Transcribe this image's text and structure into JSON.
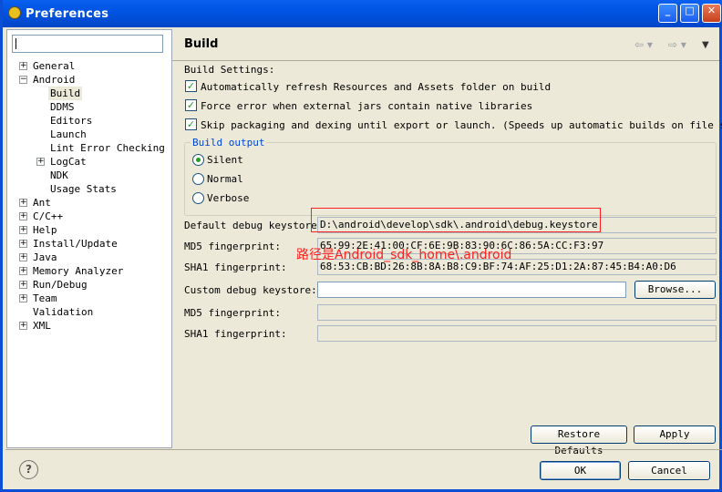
{
  "window": {
    "title": "Preferences",
    "min_glyph": "_",
    "max_glyph": "□",
    "close_glyph": "✕"
  },
  "filter": {
    "value": ""
  },
  "tree": [
    {
      "label": "General",
      "expander": "+"
    },
    {
      "label": "Android",
      "expander": "−"
    },
    {
      "label": "Build",
      "selected": true
    },
    {
      "label": "DDMS"
    },
    {
      "label": "Editors"
    },
    {
      "label": "Launch"
    },
    {
      "label": "Lint Error Checking"
    },
    {
      "label": "LogCat",
      "expander": "+"
    },
    {
      "label": "NDK"
    },
    {
      "label": "Usage Stats"
    },
    {
      "label": "Ant",
      "expander": "+"
    },
    {
      "label": "C/C++",
      "expander": "+"
    },
    {
      "label": "Help",
      "expander": "+"
    },
    {
      "label": "Install/Update",
      "expander": "+"
    },
    {
      "label": "Java",
      "expander": "+"
    },
    {
      "label": "Memory Analyzer",
      "expander": "+"
    },
    {
      "label": "Run/Debug",
      "expander": "+"
    },
    {
      "label": "Team",
      "expander": "+"
    },
    {
      "label": "Validation"
    },
    {
      "label": "XML",
      "expander": "+"
    }
  ],
  "page": {
    "title": "Build",
    "nav_back": "⇦ ▾",
    "nav_forward": "⇨ ▾",
    "nav_menu": "▼",
    "settings_label": "Build Settings:",
    "checkboxes": [
      {
        "label": "Automatically refresh Resources and Assets folder on build",
        "checked": true
      },
      {
        "label": "Force error when external jars contain native libraries",
        "checked": true
      },
      {
        "label": "Skip packaging and dexing until export or launch. (Speeds up automatic builds on file save)",
        "checked": true
      }
    ],
    "check_glyph": "✓",
    "build_output": {
      "title": "Build output",
      "options": [
        {
          "label": "Silent",
          "selected": true
        },
        {
          "label": "Normal",
          "selected": false
        },
        {
          "label": "Verbose",
          "selected": false
        }
      ]
    },
    "default_keystore_label": "Default debug keystore:",
    "default_keystore_value": "D:\\android\\develop\\sdk\\.android\\debug.keystore",
    "md5_label": "MD5 fingerprint:",
    "md5_value": "65:99:2E:41:00:CF:6E:9B:83:90:6C:86:5A:CC:F3:97",
    "sha1_label": "SHA1 fingerprint:",
    "sha1_value": "68:53:CB:BD:26:8B:8A:B8:C9:BF:74:AF:25:D1:2A:87:45:B4:A0:D6",
    "custom_keystore_label": "Custom debug keystore:",
    "custom_keystore_value": "",
    "browse_label": "Browse...",
    "custom_md5_label": "MD5 fingerprint:",
    "custom_md5_value": "",
    "custom_sha1_label": "SHA1 fingerprint:",
    "custom_sha1_value": "",
    "restore_defaults_label": "Restore Defaults",
    "apply_label": "Apply"
  },
  "annotation": {
    "text": "路径是Android_sdk_home\\.android",
    "color": "#ff2020"
  },
  "footer": {
    "help_glyph": "?",
    "ok_label": "OK",
    "cancel_label": "Cancel"
  }
}
